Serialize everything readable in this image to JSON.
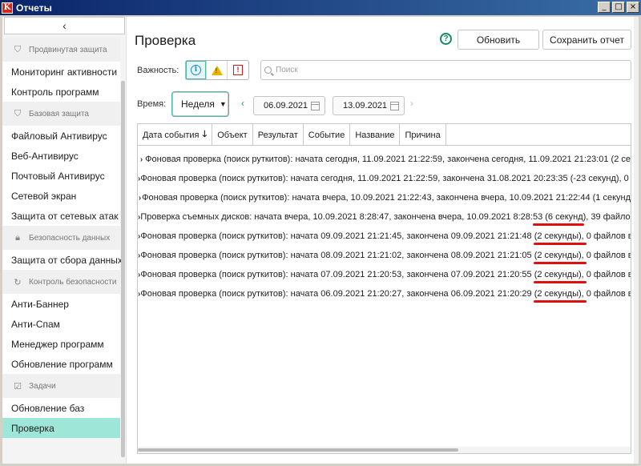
{
  "window": {
    "title": "Отчеты",
    "app_icon": "K",
    "controls": [
      "_",
      "□",
      "×"
    ]
  },
  "sidebar": {
    "back_icon": "‹",
    "sections": [
      {
        "header": "Продвинутая защита",
        "icon": "shield-plus-icon",
        "items": [
          "Мониторинг активности",
          "Контроль программ"
        ]
      },
      {
        "header": "Базовая защита",
        "icon": "shield-icon",
        "items": [
          "Файловый Антивирус",
          "Веб-Антивирус",
          "Почтовый Антивирус",
          "Сетевой экран",
          "Защита от сетевых атак"
        ]
      },
      {
        "header": "Безопасность данных",
        "icon": "lock-icon",
        "items": [
          "Защита от сбора данных"
        ]
      },
      {
        "header": "Контроль безопасности",
        "icon": "refresh-shield-icon",
        "items": [
          "Анти-Баннер",
          "Анти-Спам",
          "Менеджер программ",
          "Обновление программ"
        ]
      },
      {
        "header": "Задачи",
        "icon": "checklist-icon",
        "items": [
          "Обновление баз",
          "Проверка"
        ]
      }
    ],
    "active_item": "Проверка"
  },
  "main": {
    "title": "Проверка",
    "help_icon": "?",
    "buttons": {
      "refresh": "Обновить",
      "save": "Сохранить отчет"
    },
    "severity_label": "Важность:",
    "search_placeholder": "Поиск",
    "time_label": "Время:",
    "period_value": "Неделя",
    "date_from": "06.09.2021",
    "date_to": "13.09.2021",
    "columns": [
      "Дата события",
      "Объект",
      "Результат",
      "Событие",
      "Название",
      "Причина"
    ],
    "sort_indicator": "🡓",
    "rows": [
      "Фоновая проверка (поиск руткитов): начата сегодня, 11.09.2021 21:22:59, закончена сегодня, 11.09.2021 21:23:01 (2 се",
      "Фоновая проверка (поиск руткитов): начата сегодня, 11.09.2021 21:22:59, закончена 31.08.2021 20:23:35 (-23 секунд), 0 ф",
      "Фоновая проверка (поиск руткитов): начата вчера, 10.09.2021 21:22:43, закончена вчера, 10.09.2021 21:22:44 (1 секунд",
      "Проверка съемных дисков: начата вчера, 10.09.2021 8:28:47, закончена вчера, 10.09.2021 8:28:53 (6 секунд), 39 файлов",
      "Фоновая проверка (поиск руткитов): начата 09.09.2021 21:21:45, закончена 09.09.2021 21:21:48 (2 секунды), 0 файлов в",
      "Фоновая проверка (поиск руткитов): начата 08.09.2021 21:21:02, закончена 08.09.2021 21:21:05 (2 секунды), 0 файлов в",
      "Фоновая проверка (поиск руткитов): начата 07.09.2021 21:20:53, закончена 07.09.2021 21:20:55 (2 секунды), 0 файлов в",
      "Фоновая проверка (поиск руткитов): начата 06.09.2021 21:20:27, закончена 06.09.2021 21:20:29 (2 секунды), 0 файлов в"
    ],
    "highlighted_rows": [
      3,
      4,
      5,
      6,
      7
    ]
  },
  "colors": {
    "accent": "#23a089",
    "active_item": "#9ee7d8",
    "highlight": "#e01010"
  }
}
